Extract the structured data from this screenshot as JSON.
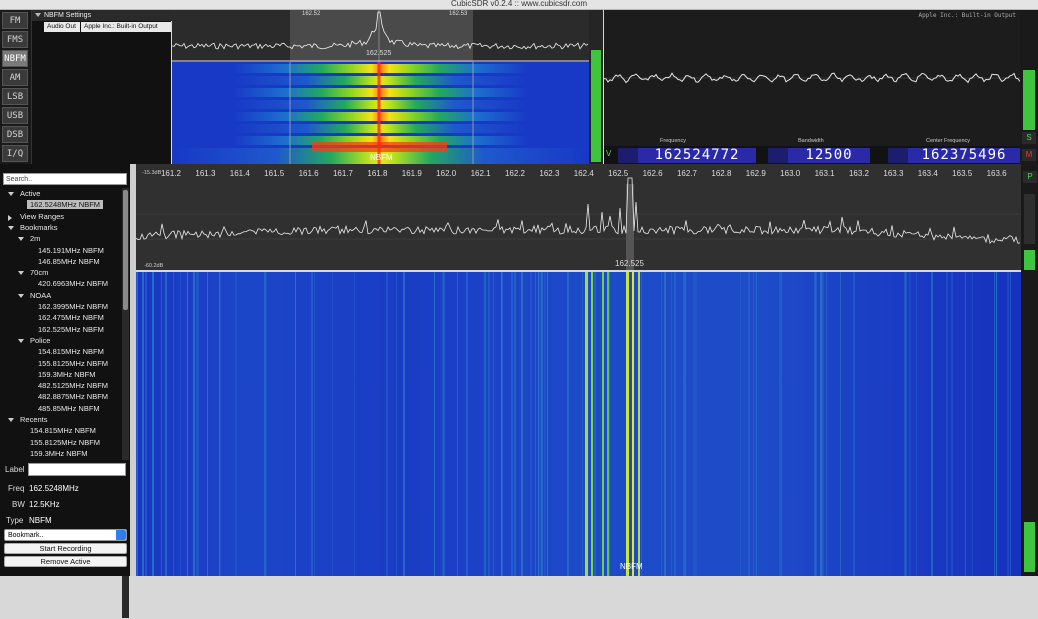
{
  "window": {
    "title": "CubicSDR v0.2.4 :: www.cubicsdr.com"
  },
  "modes": [
    "FM",
    "FMS",
    "NBFM",
    "AM",
    "LSB",
    "USB",
    "DSB",
    "I/Q"
  ],
  "active_mode": "NBFM",
  "mod_panel": {
    "header": "NBFM Settings",
    "audio_label": "Audio Out",
    "audio_device": "Apple Inc.: Built-in Output"
  },
  "small_spectrum": {
    "tick_left": "162.52",
    "tick_right": "162.53",
    "center_label": "162.525",
    "wf_label": "NBFM"
  },
  "scope": {
    "device_label": "Apple Inc.: Built-in Output"
  },
  "digits": {
    "frequency_label": "Frequency",
    "frequency": "162524772",
    "bandwidth_label": "Bandwidth",
    "bandwidth": "12500",
    "center_label": "Center Frequency",
    "center": "162375496",
    "v_label": "V"
  },
  "side": {
    "s": "S",
    "m": "M",
    "p": "P"
  },
  "left": {
    "search_placeholder": "Search..",
    "tree": [
      {
        "text": "Active",
        "level": 0,
        "tri": "down"
      },
      {
        "text": "162.5248MHz NBFM",
        "level": 1,
        "selected": true
      },
      {
        "text": "View Ranges",
        "level": 0,
        "tri": "right"
      },
      {
        "text": "Bookmarks",
        "level": 0,
        "tri": "down"
      },
      {
        "text": "2m",
        "level": 1,
        "tri": "down"
      },
      {
        "text": "145.191MHz NBFM",
        "level": 2
      },
      {
        "text": "146.85MHz NBFM",
        "level": 2
      },
      {
        "text": "70cm",
        "level": 1,
        "tri": "down"
      },
      {
        "text": "420.6963MHz NBFM",
        "level": 2
      },
      {
        "text": "NOAA",
        "level": 1,
        "tri": "down"
      },
      {
        "text": "162.3995MHz NBFM",
        "level": 2
      },
      {
        "text": "162.475MHz NBFM",
        "level": 2
      },
      {
        "text": "162.525MHz NBFM",
        "level": 2
      },
      {
        "text": "Police",
        "level": 1,
        "tri": "down"
      },
      {
        "text": "154.815MHz NBFM",
        "level": 2
      },
      {
        "text": "155.8125MHz NBFM",
        "level": 2
      },
      {
        "text": "159.3MHz NBFM",
        "level": 2
      },
      {
        "text": "482.5125MHz NBFM",
        "level": 2
      },
      {
        "text": "482.8875MHz NBFM",
        "level": 2
      },
      {
        "text": "485.85MHz NBFM",
        "level": 2
      },
      {
        "text": "Recents",
        "level": 0,
        "tri": "down"
      },
      {
        "text": "154.815MHz NBFM",
        "level": 1
      },
      {
        "text": "155.8125MHz NBFM",
        "level": 1
      },
      {
        "text": "159.3MHz NBFM",
        "level": 1
      }
    ],
    "props": {
      "label_key": "Label",
      "label_value": "",
      "freq_key": "Freq",
      "freq_value": "162.5248MHz",
      "bw_key": "BW",
      "bw_value": "12.5KHz",
      "type_key": "Type",
      "type_value": "NBFM"
    },
    "bookmark_select": "Bookmark..",
    "start_recording": "Start Recording",
    "remove_active": "Remove Active"
  },
  "main_spectrum": {
    "ticks": [
      "161.2",
      "161.3",
      "161.4",
      "161.5",
      "161.6",
      "161.7",
      "161.8",
      "161.9",
      "162.0",
      "162.1",
      "162.2",
      "162.3",
      "162.4",
      "162.5",
      "162.6",
      "162.7",
      "162.8",
      "162.9",
      "163.0",
      "163.1",
      "163.2",
      "163.3",
      "163.4",
      "163.5",
      "163.6"
    ],
    "db_top": "-15.3dB",
    "db_bottom": "-60.2dB",
    "center_label": "162.525",
    "wf_label": "NBFM"
  },
  "colors": {
    "meter_green": "#3ec43e",
    "digit_blue": "#2a2aa8",
    "wf_blue": "#1b32c8"
  }
}
